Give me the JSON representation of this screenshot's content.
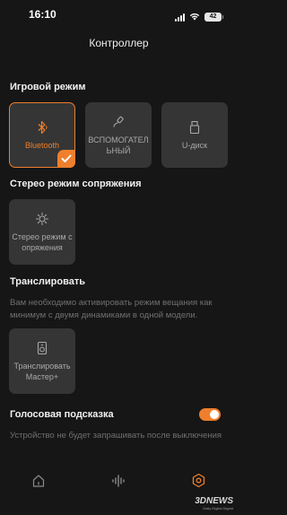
{
  "status": {
    "time": "16:10",
    "battery": "42"
  },
  "header": {
    "title": "Контроллер"
  },
  "game_mode": {
    "title": "Игровой режим",
    "options": [
      {
        "label": "Bluetooth",
        "icon": "bluetooth-icon",
        "selected": true
      },
      {
        "label": "ВСПОМОГАТЕЛЬНЫЙ",
        "icon": "cable-icon",
        "selected": false
      },
      {
        "label": "U-диск",
        "icon": "usb-disk-icon",
        "selected": false
      }
    ]
  },
  "stereo": {
    "title": "Стерео режим сопряжения",
    "tile_label": "Стерео режим сопряжения",
    "icon": "stereo-pair-icon"
  },
  "broadcast": {
    "title": "Транслировать",
    "description": "Вам необходимо активировать режим вещания как минимум с двумя динамиками в одной модели.",
    "tile_label": "Транслировать Мастер+",
    "icon": "speaker-icon"
  },
  "voice": {
    "title": "Голосовая подсказка",
    "enabled": true,
    "description": "Устройство не будет запрашивать после выключения"
  },
  "tabs": [
    {
      "name": "home",
      "icon": "home-icon",
      "active": false
    },
    {
      "name": "equalizer",
      "icon": "sound-wave-icon",
      "active": false
    },
    {
      "name": "controller",
      "icon": "hexagon-gear-icon",
      "active": true
    }
  ],
  "watermark": {
    "logo": "3DNEWS",
    "tagline": "Daily Digital Digest"
  },
  "colors": {
    "accent": "#ef7f2c",
    "background": "#161616",
    "tile": "#353535"
  }
}
